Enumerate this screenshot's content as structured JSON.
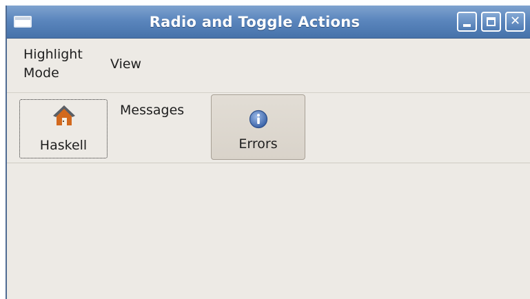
{
  "window": {
    "title": "Radio and Toggle Actions",
    "controls": [
      "minimize",
      "maximize",
      "close"
    ]
  },
  "menubar": {
    "items": [
      {
        "label": "Highlight\nMode"
      },
      {
        "label": "View"
      }
    ]
  },
  "toolbar": {
    "items": [
      {
        "label": "Haskell",
        "icon": "home-icon",
        "focused": true
      },
      {
        "label": "Messages",
        "icon": null
      },
      {
        "label": "Errors",
        "icon": "info-icon",
        "pressed": true
      }
    ]
  },
  "colors": {
    "titlebar": "#5b86bd",
    "window_bg": "#edeae5",
    "pressed_button": "#ddd7ce"
  }
}
